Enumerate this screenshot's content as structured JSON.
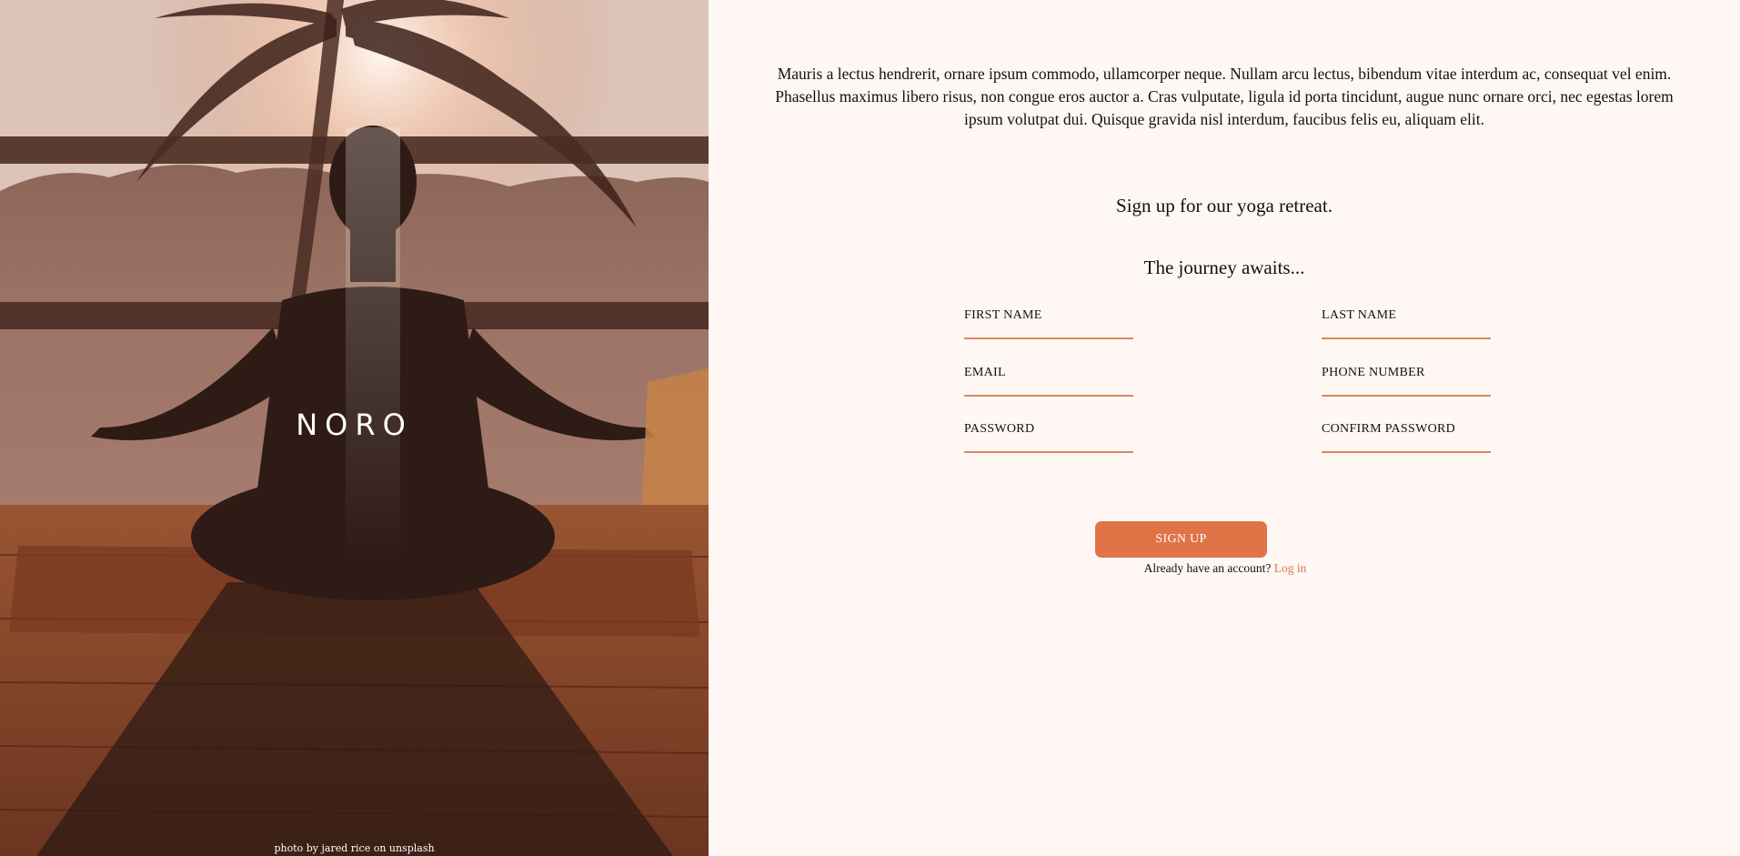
{
  "hero": {
    "brand": "NORO",
    "credit": "photo by jared rice on unsplash"
  },
  "intro": {
    "text": "Mauris a lectus hendrerit, ornare ipsum commodo, ullamcorper neque. Nullam arcu lectus, bibendum vitae interdum ac, consequat vel enim. Phasellus maximus libero risus, non congue eros auctor a. Cras vulputate, ligula id porta tincidunt, augue nunc ornare orci, nec egestas lorem ipsum volutpat dui. Quisque gravida nisl interdum, faucibus felis eu, aliquam elit."
  },
  "form": {
    "heading": "Sign up for our yoga retreat.",
    "subheading": "The journey awaits...",
    "fields": {
      "first_name": "FIRST NAME",
      "last_name": "LAST NAME",
      "email": "EMAIL",
      "phone": "PHONE NUMBER",
      "password": "PASSWORD",
      "confirm_password": "CONFIRM PASSWORD"
    },
    "submit_label": "SIGN UP",
    "login_prompt": "Already have an account?",
    "login_link": "Log in"
  },
  "colors": {
    "background": "#fff7f3",
    "accent": "#e07447",
    "underline": "#d9875f"
  }
}
